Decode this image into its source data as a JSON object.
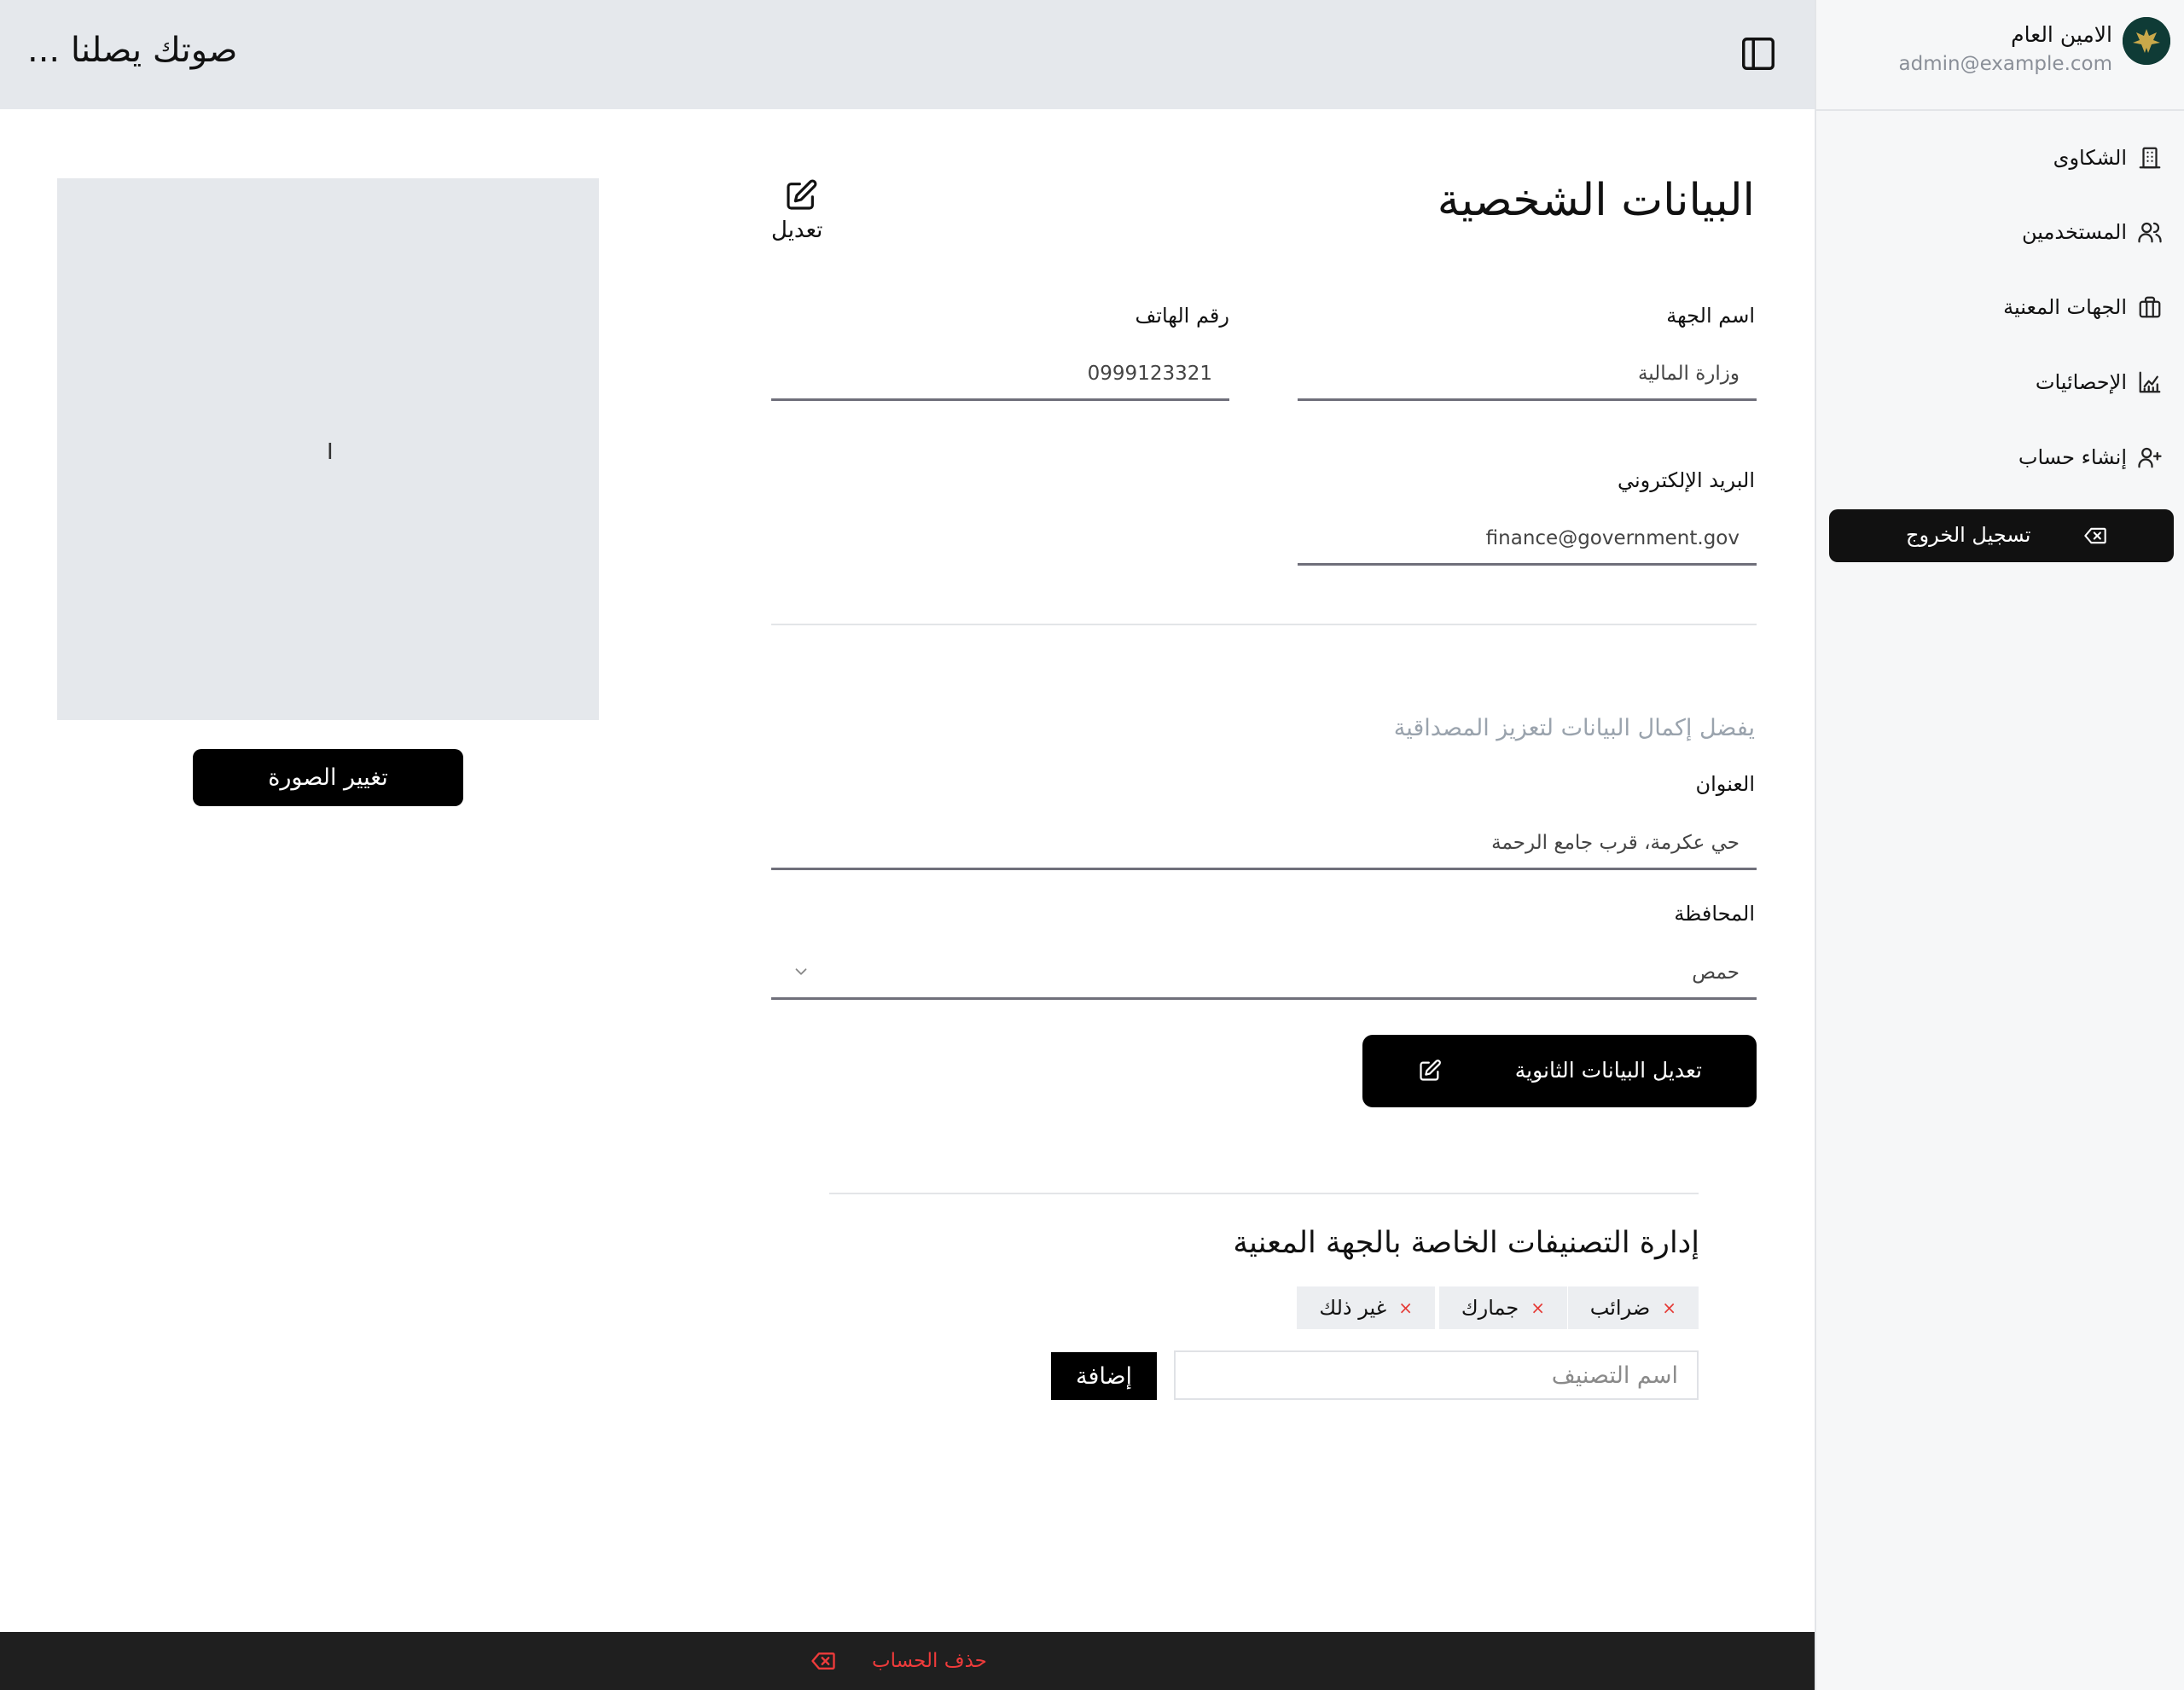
{
  "header": {
    "brand": "صوتك يصلنا ..."
  },
  "user": {
    "name": "الامين العام",
    "email": "admin@example.com"
  },
  "sidebar": {
    "items": [
      {
        "label": "الشكاوى",
        "icon": "building-icon"
      },
      {
        "label": "المستخدمين",
        "icon": "users-icon"
      },
      {
        "label": "الجهات المعنية",
        "icon": "briefcase-icon"
      },
      {
        "label": "الإحصائيات",
        "icon": "chart-icon"
      },
      {
        "label": "إنشاء حساب",
        "icon": "user-plus-icon"
      }
    ],
    "logout_label": "تسجيل الخروج"
  },
  "profile": {
    "title": "البيانات الشخصية",
    "edit_label": "تعديل",
    "fields": {
      "entity_name": {
        "label": "اسم الجهة",
        "value": "وزارة المالية"
      },
      "phone": {
        "label": "رقم الهاتف",
        "value": "0999123321"
      },
      "email": {
        "label": "البريد الإلكتروني",
        "value": "finance@government.gov"
      }
    },
    "hint": "يفضل إكمال البيانات لتعزيز المصداقية",
    "address": {
      "label": "العنوان",
      "value": "حي عكرمة، قرب جامع الرحمة"
    },
    "governorate": {
      "label": "المحافظة",
      "value": "حمص"
    },
    "secondary_edit_label": "تعديل البيانات الثانوية"
  },
  "photo": {
    "cursor_glyph": "I",
    "change_label": "تغيير الصورة"
  },
  "categories": {
    "title": "إدارة التصنيفات الخاصة بالجهة المعنية",
    "chips": [
      "ضرائب",
      "جمارك",
      "غير ذلك"
    ],
    "remove_glyph": "×",
    "input_placeholder": "اسم التصنيف",
    "add_label": "إضافة"
  },
  "footer": {
    "delete_label": "حذف الحساب"
  },
  "colors": {
    "accent": "#000000",
    "danger": "#ef3b3b",
    "hint": "#9aa3ad",
    "avatar_bg": "#0f3b36"
  }
}
